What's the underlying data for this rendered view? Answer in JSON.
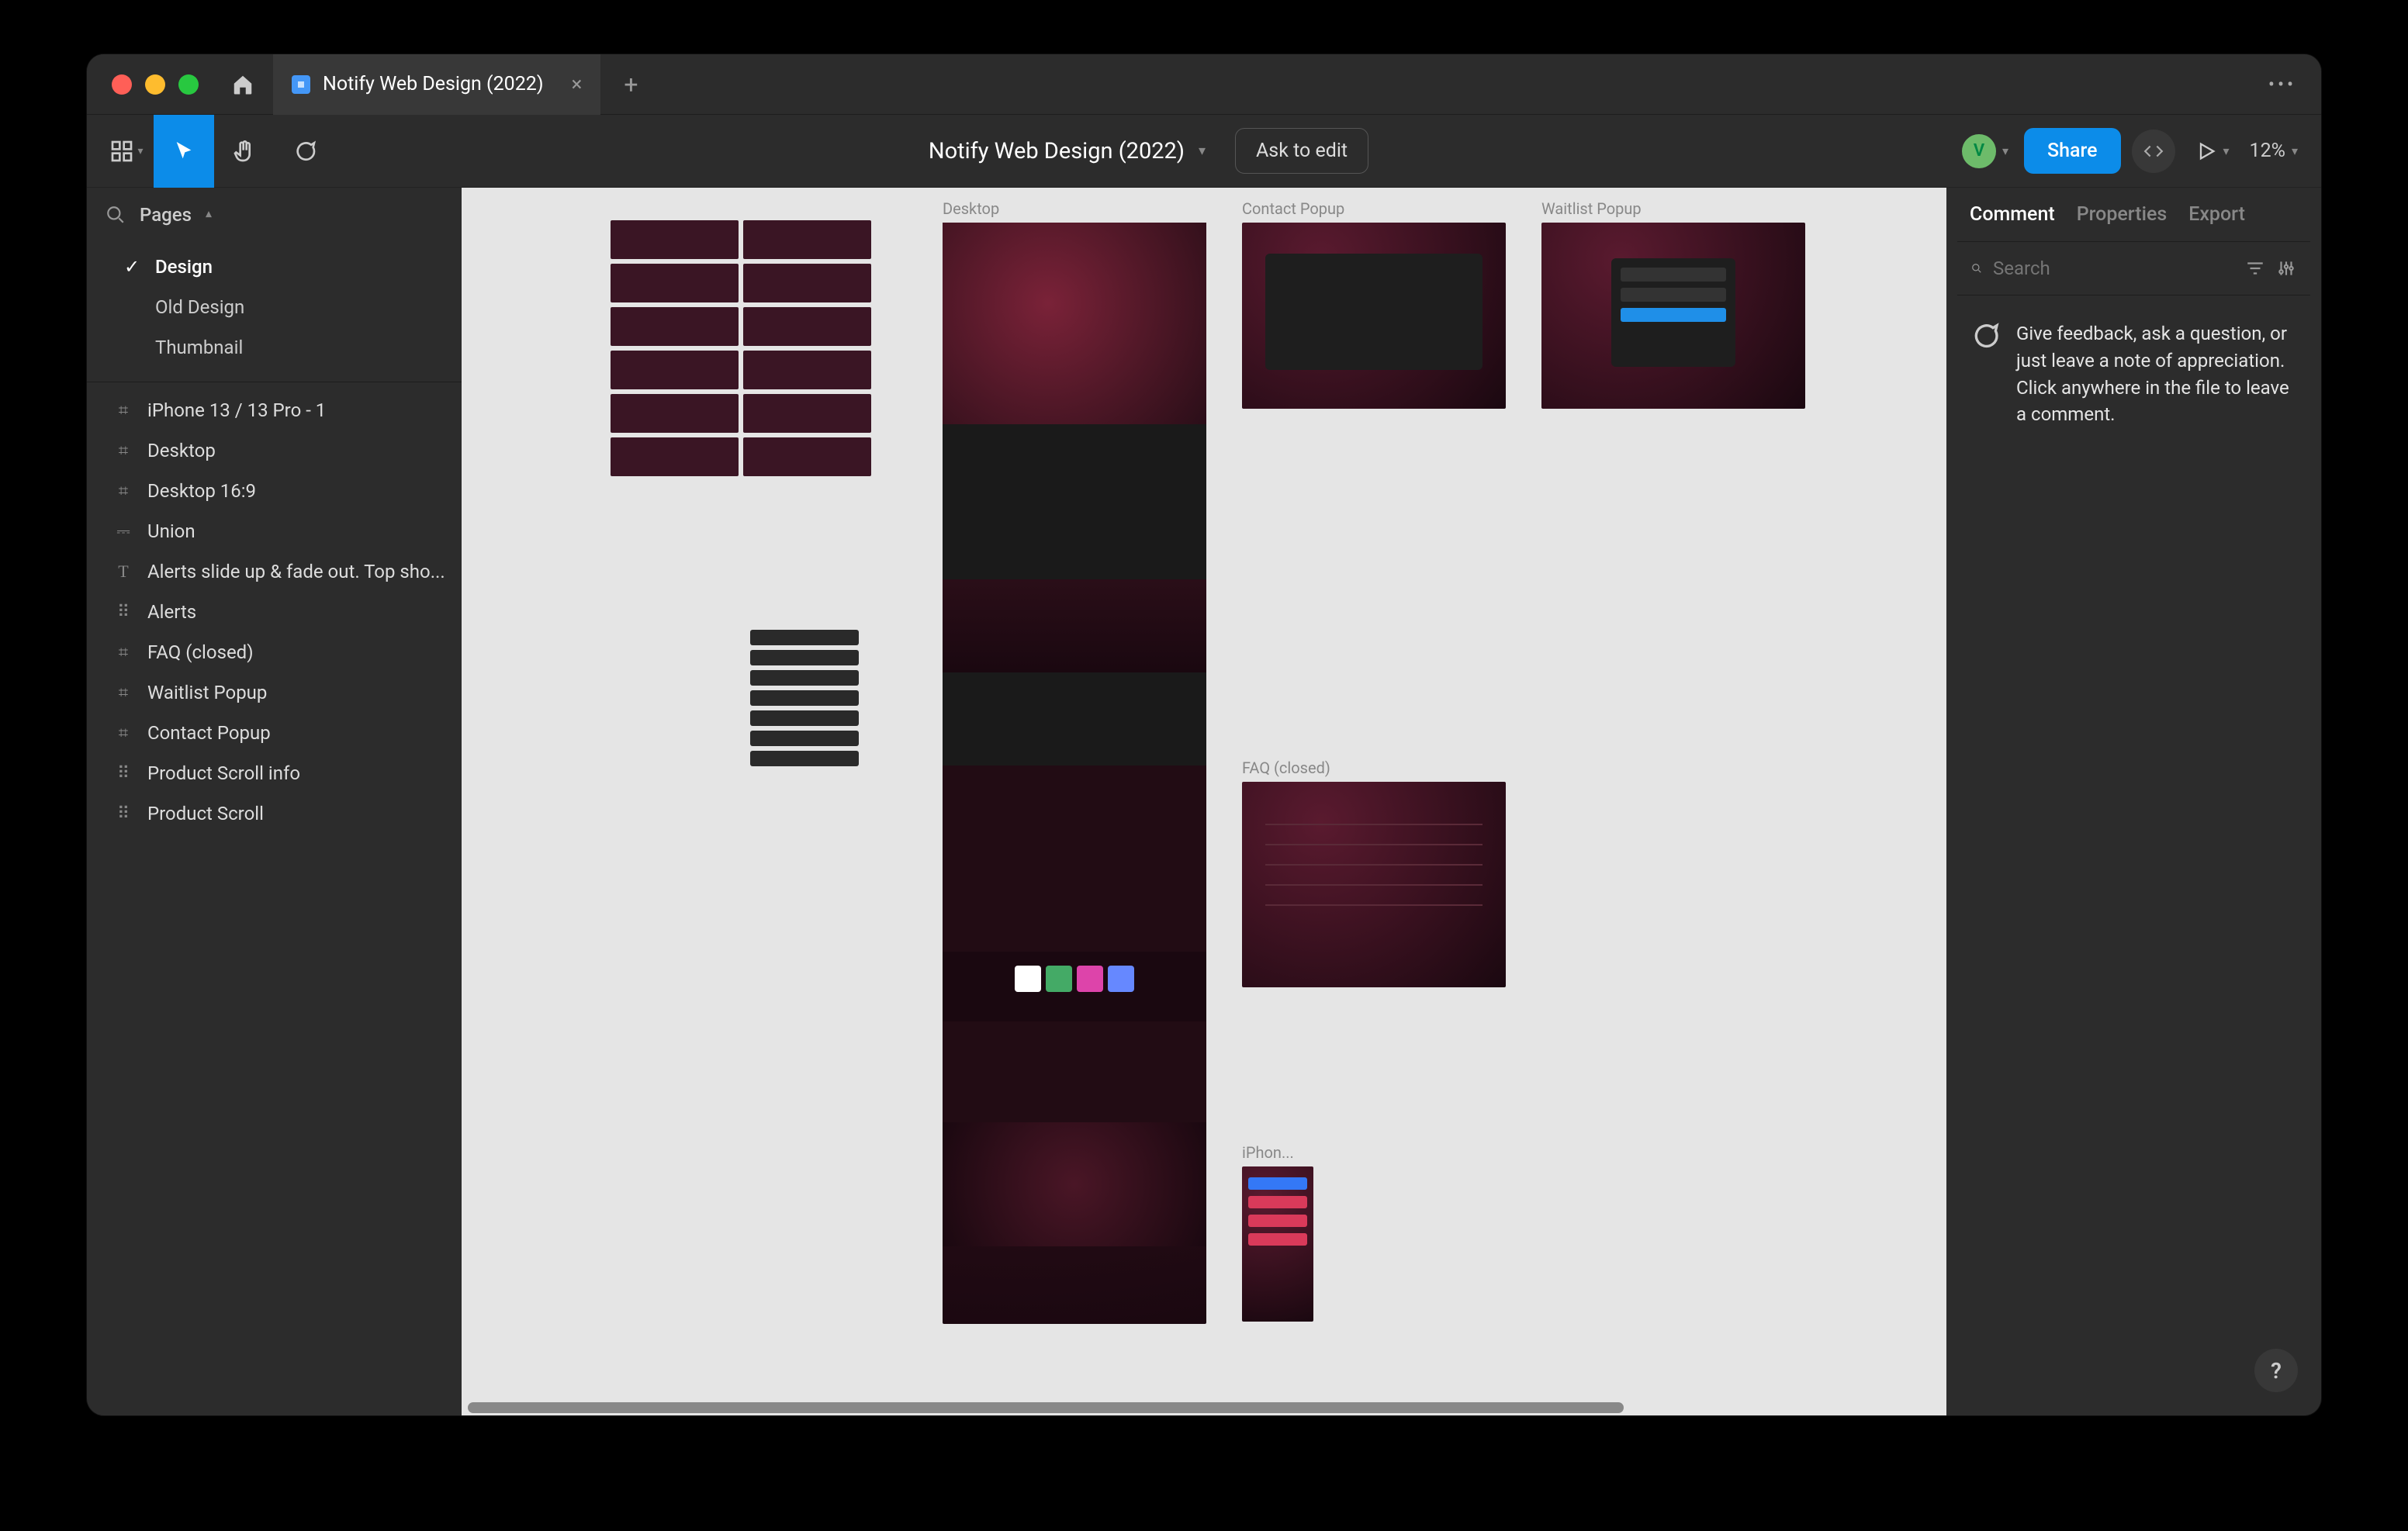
{
  "titlebar": {
    "tab_title": "Notify Web Design (2022)"
  },
  "toolbar": {
    "file_title": "Notify Web Design (2022)",
    "ask_to_edit": "Ask to edit",
    "share": "Share",
    "avatar_letter": "V",
    "zoom": "12%"
  },
  "left_panel": {
    "pages_label": "Pages",
    "pages": [
      {
        "name": "Design",
        "selected": true
      },
      {
        "name": "Old Design",
        "selected": false
      },
      {
        "name": "Thumbnail",
        "selected": false
      }
    ],
    "layers": [
      {
        "name": "iPhone 13 / 13 Pro - 1",
        "icon": "frame"
      },
      {
        "name": "Desktop",
        "icon": "frame"
      },
      {
        "name": "Desktop 16:9",
        "icon": "frame"
      },
      {
        "name": "Union",
        "icon": "union"
      },
      {
        "name": "Alerts slide up & fade out. Top sho...",
        "icon": "text"
      },
      {
        "name": "Alerts",
        "icon": "group"
      },
      {
        "name": "FAQ (closed)",
        "icon": "frame"
      },
      {
        "name": "Waitlist Popup",
        "icon": "frame"
      },
      {
        "name": "Contact Popup",
        "icon": "frame"
      },
      {
        "name": "Product Scroll info",
        "icon": "group"
      },
      {
        "name": "Product Scroll",
        "icon": "group"
      }
    ]
  },
  "canvas": {
    "frames": {
      "desktop": "Desktop",
      "contact_popup": "Contact Popup",
      "waitlist_popup": "Waitlist Popup",
      "faq_closed": "FAQ (closed)",
      "iphone": "iPhon..."
    }
  },
  "right_panel": {
    "tabs": {
      "comment": "Comment",
      "properties": "Properties",
      "export": "Export"
    },
    "search_placeholder": "Search",
    "comment_hint": "Give feedback, ask a question, or just leave a note of appreciation. Click anywhere in the file to leave a comment."
  },
  "help": "?"
}
